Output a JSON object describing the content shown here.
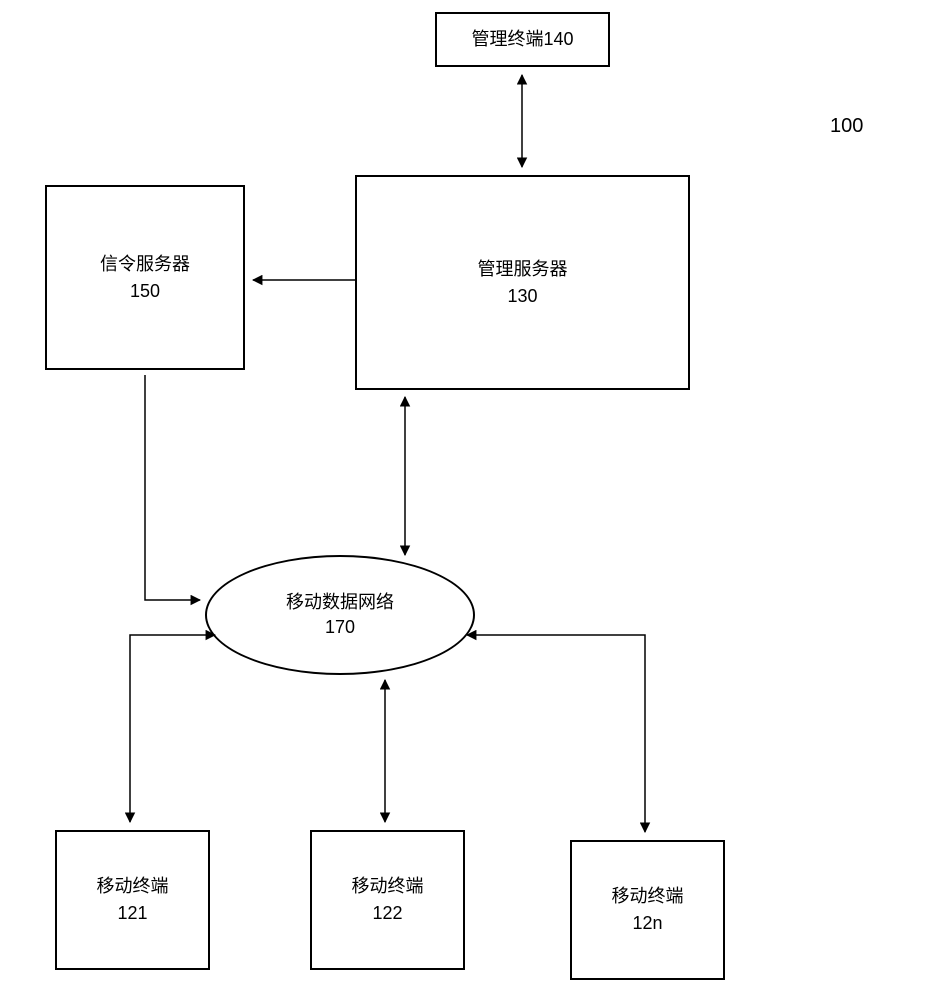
{
  "diagram_label": "100",
  "nodes": {
    "management_terminal": {
      "label": "管理终端140"
    },
    "signaling_server": {
      "name": "信令服务器",
      "id": "150"
    },
    "management_server": {
      "name": "管理服务器",
      "id": "130"
    },
    "mobile_data_network": {
      "name": "移动数据网络",
      "id": "170"
    },
    "mobile_terminal_1": {
      "name": "移动终端",
      "id": "121"
    },
    "mobile_terminal_2": {
      "name": "移动终端",
      "id": "122"
    },
    "mobile_terminal_n": {
      "name": "移动终端",
      "id": "12n"
    }
  }
}
